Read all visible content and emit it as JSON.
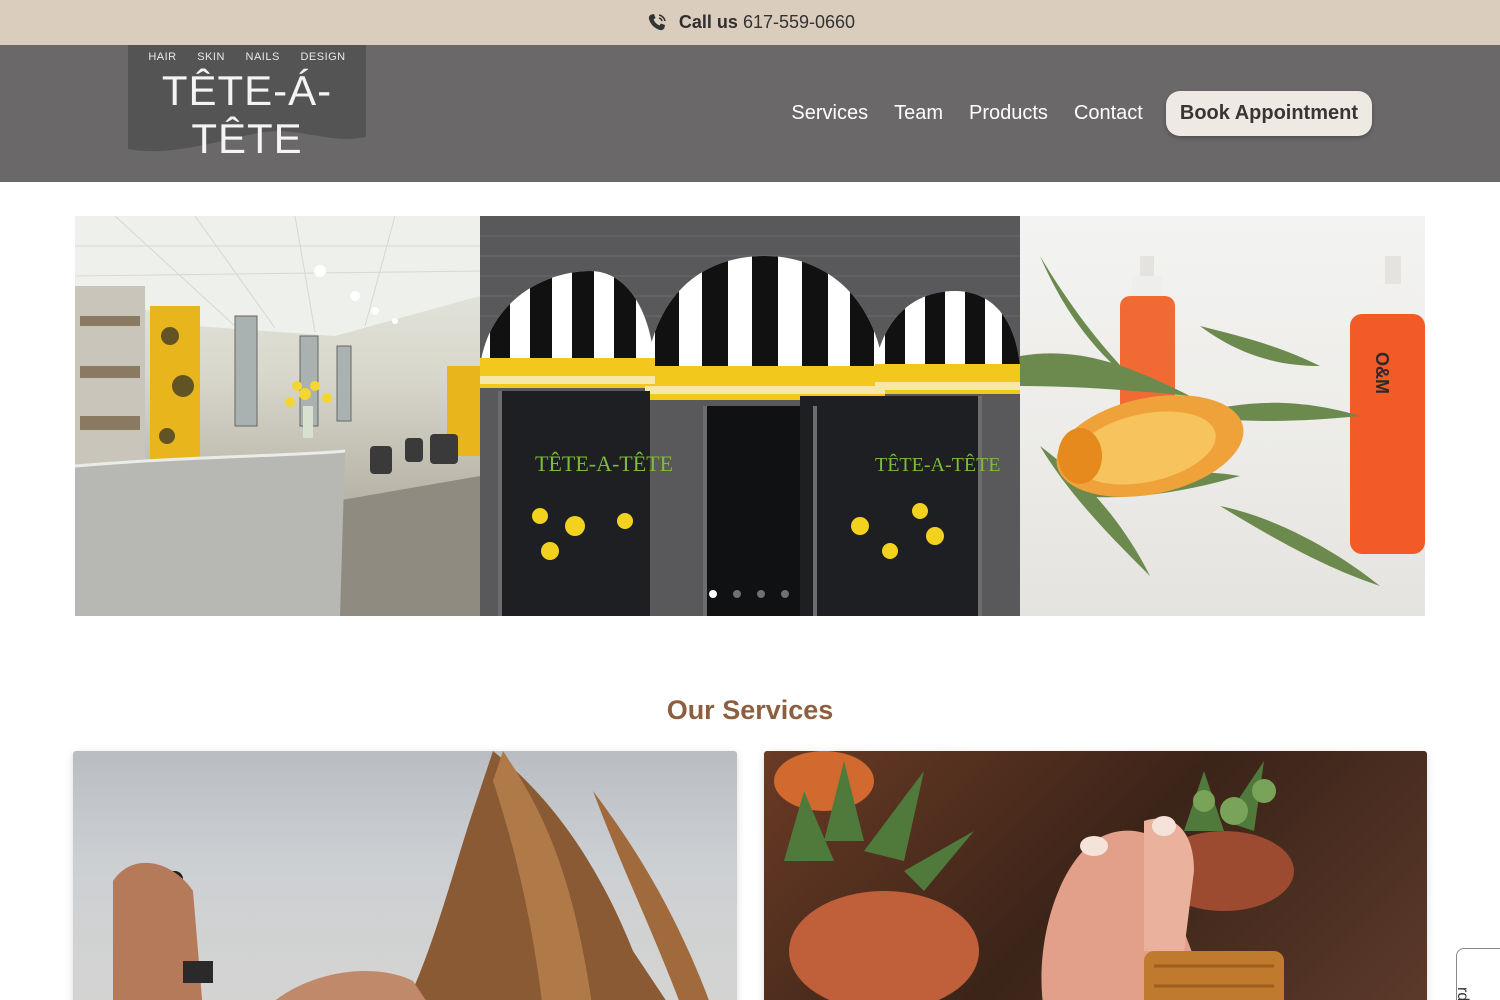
{
  "topbar": {
    "call_label": "Call us",
    "phone": "617-559-0660",
    "icon": "phone-icon"
  },
  "logo": {
    "subtitle": [
      "HAIR",
      "SKIN",
      "NAILS",
      "DESIGN"
    ],
    "name": "TÊTE-Á-TÊTE"
  },
  "nav": {
    "items": [
      "Services",
      "Team",
      "Products",
      "Contact"
    ],
    "book_label": "Book Appointment"
  },
  "slider": {
    "awning_sign_left": "TÊTE-A-TÊTE",
    "awning_sign_right": "TÊTE-A-TÊTE",
    "product_label": "O&M",
    "slide_count": 4,
    "active_slide": 1
  },
  "services": {
    "title": "Our Services"
  },
  "side_tab": {
    "label": "rds"
  },
  "colors": {
    "topbar_bg": "#dbcdbd",
    "header_bg": "#6b6869",
    "accent_title": "#8d5f3f",
    "button_bg": "#efe9e4"
  }
}
